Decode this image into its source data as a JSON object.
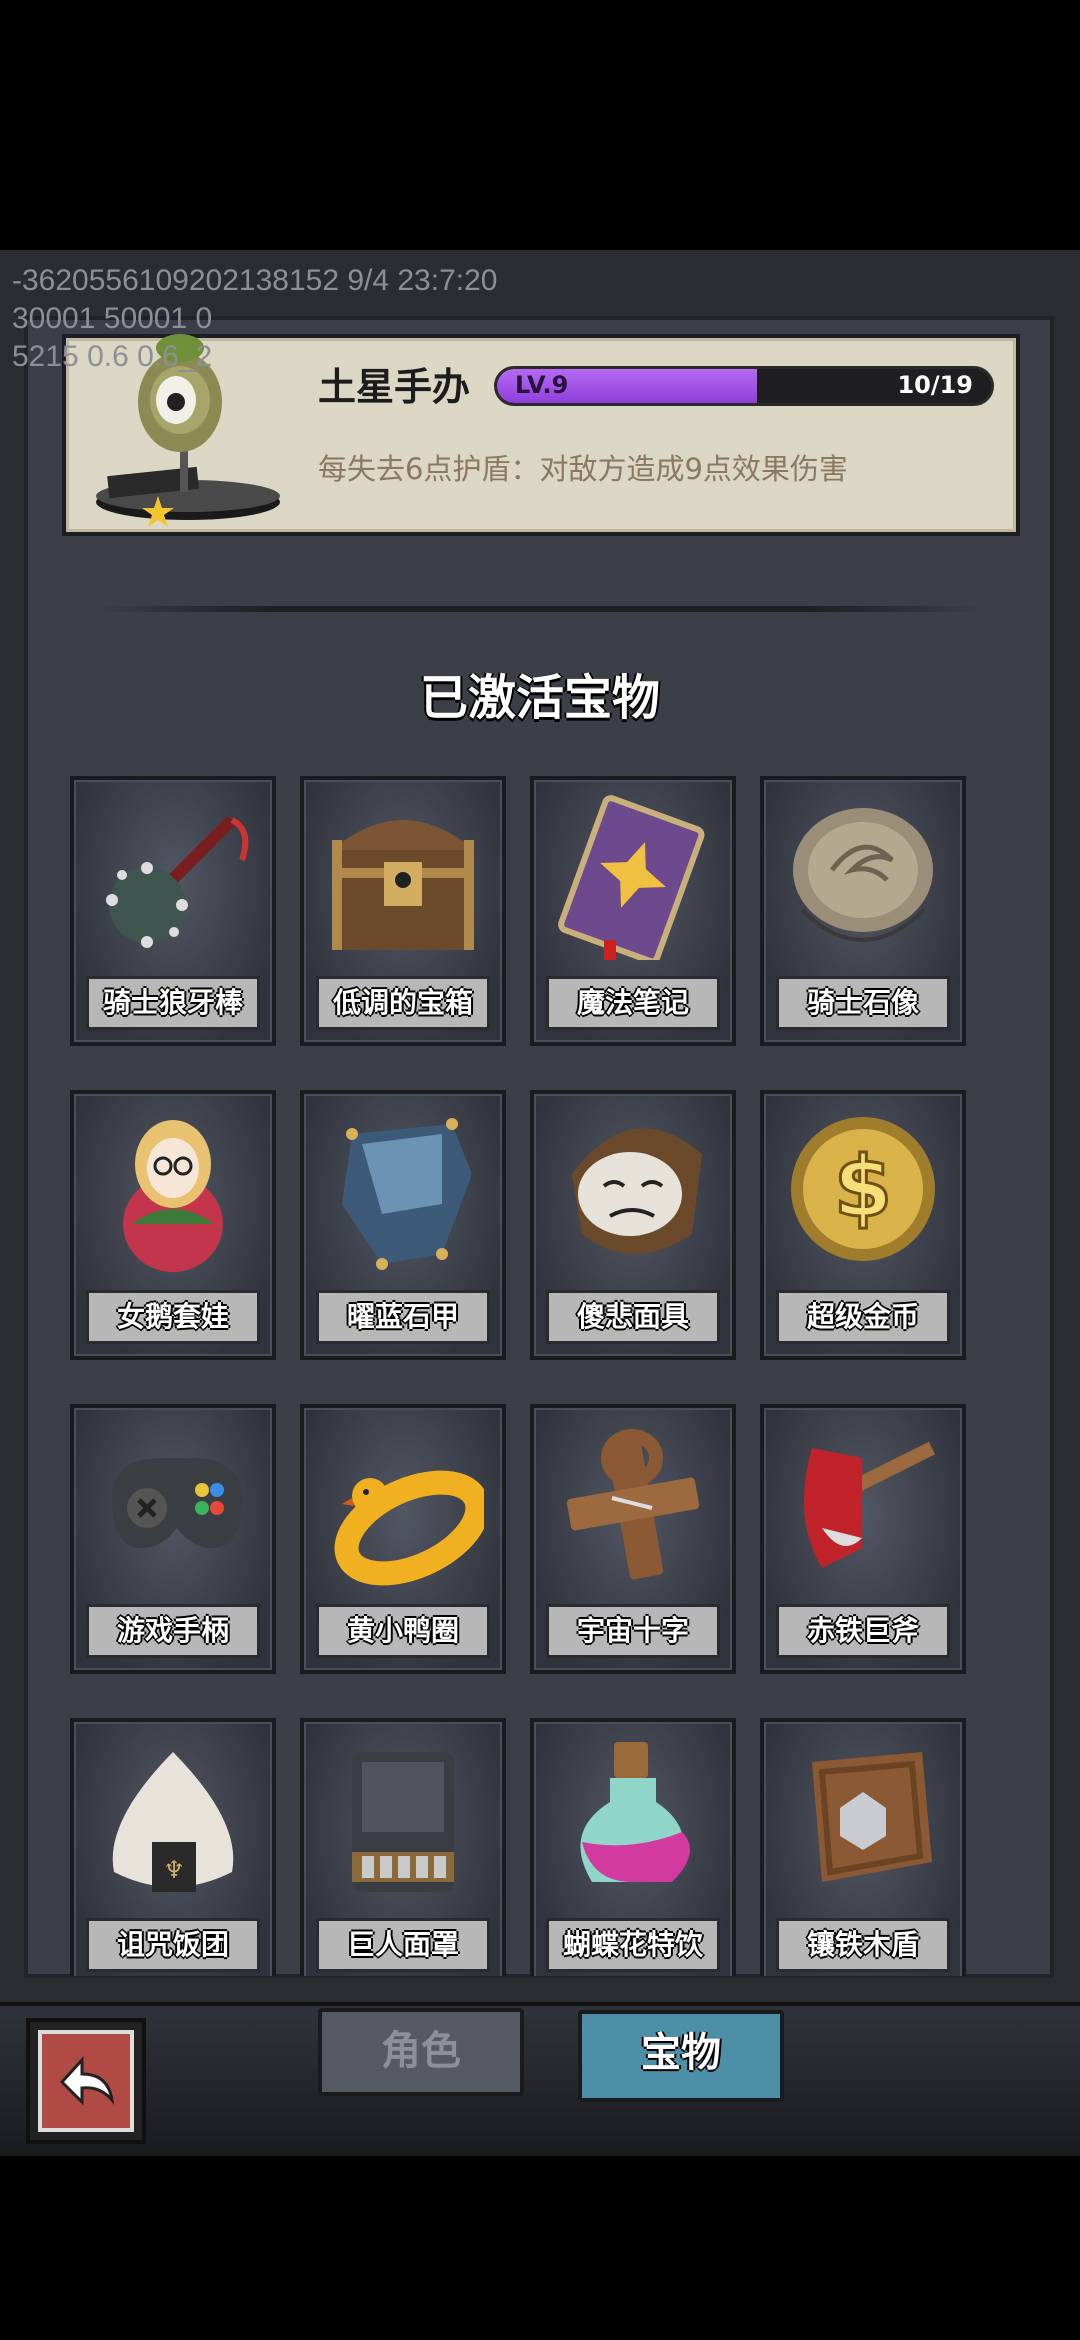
{
  "debug": {
    "line1": "-3620556109202138152 9/4 23:7:20",
    "line2": "30001 50001 0",
    "line3": "5215 0.6 0.6_2"
  },
  "selected": {
    "name": "土星手办",
    "level_label": "LV.9",
    "progress_label": "10/19",
    "progress": 0.526,
    "description": "每失去6点护盾：对敌方造成9点效果伤害"
  },
  "section_title": "已激活宝物",
  "items": [
    {
      "label": "骑士狼牙棒",
      "icon": "spiked-mace-icon"
    },
    {
      "label": "低调的宝箱",
      "icon": "treasure-chest-icon"
    },
    {
      "label": "魔法笔记",
      "icon": "spell-book-icon"
    },
    {
      "label": "骑士石像",
      "icon": "stone-tablet-icon"
    },
    {
      "label": "女鹅套娃",
      "icon": "nesting-doll-icon"
    },
    {
      "label": "曜蓝石甲",
      "icon": "blue-armor-icon"
    },
    {
      "label": "傻悲面具",
      "icon": "sad-mask-icon"
    },
    {
      "label": "超级金币",
      "icon": "gold-coin-icon"
    },
    {
      "label": "游戏手柄",
      "icon": "gamepad-icon"
    },
    {
      "label": "黄小鸭圈",
      "icon": "duck-float-ring-icon"
    },
    {
      "label": "宇宙十字",
      "icon": "wooden-cross-icon"
    },
    {
      "label": "赤铁巨斧",
      "icon": "red-axe-icon"
    },
    {
      "label": "诅咒饭团",
      "icon": "rice-ball-icon"
    },
    {
      "label": "巨人面罩",
      "icon": "giant-mask-icon"
    },
    {
      "label": "蝴蝶花特饮",
      "icon": "potion-bottle-icon"
    },
    {
      "label": "镶铁木盾",
      "icon": "wooden-shield-icon"
    }
  ],
  "tabs": {
    "role": "角色",
    "treasure": "宝物"
  },
  "colors": {
    "level_fill": "#a556ea",
    "active_tab": "#4c8fa7",
    "back_button": "#b04a44"
  }
}
